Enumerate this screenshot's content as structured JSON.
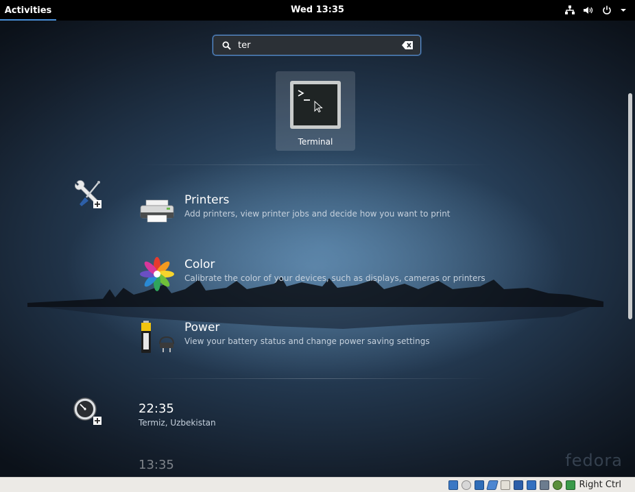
{
  "topbar": {
    "activities": "Activities",
    "clock": "Wed 13:35",
    "tray_icons": [
      "network-icon",
      "volume-icon",
      "power-icon",
      "dropdown-icon"
    ]
  },
  "search": {
    "value": "ter",
    "icon": "search-icon",
    "clear_icon": "clear-icon"
  },
  "app_results": [
    {
      "label": "Terminal",
      "icon": "terminal-icon"
    }
  ],
  "settings_provider": {
    "icon": "settings-tools-icon",
    "results": [
      {
        "title": "Printers",
        "description": "Add printers, view printer jobs and decide how you want to print",
        "icon": "printer-icon"
      },
      {
        "title": "Color",
        "description": "Calibrate the color of your devices, such as displays, cameras or printers",
        "icon": "color-icon"
      },
      {
        "title": "Power",
        "description": "View your battery status and change power saving settings",
        "icon": "battery-icon"
      }
    ]
  },
  "clocks_provider": {
    "icon": "clocks-icon",
    "results": [
      {
        "time": "22:35",
        "place": "Termiz, Uzbekistan"
      },
      {
        "time": "13:35",
        "place": ""
      }
    ]
  },
  "watermark": "fedora",
  "status_bar": {
    "host_key": "Right Ctrl",
    "icons": [
      "hard-disk-icon",
      "optical-drive-icon",
      "audio-icon",
      "usb-icon",
      "shared-folders-icon",
      "display-icon",
      "network-adapter-icon",
      "recording-icon",
      "cpu-icon",
      "mouse-integration-icon"
    ]
  },
  "colors": {
    "accent": "#4a90d9",
    "topbar": "#000000",
    "status_bar": "#eceae6"
  }
}
